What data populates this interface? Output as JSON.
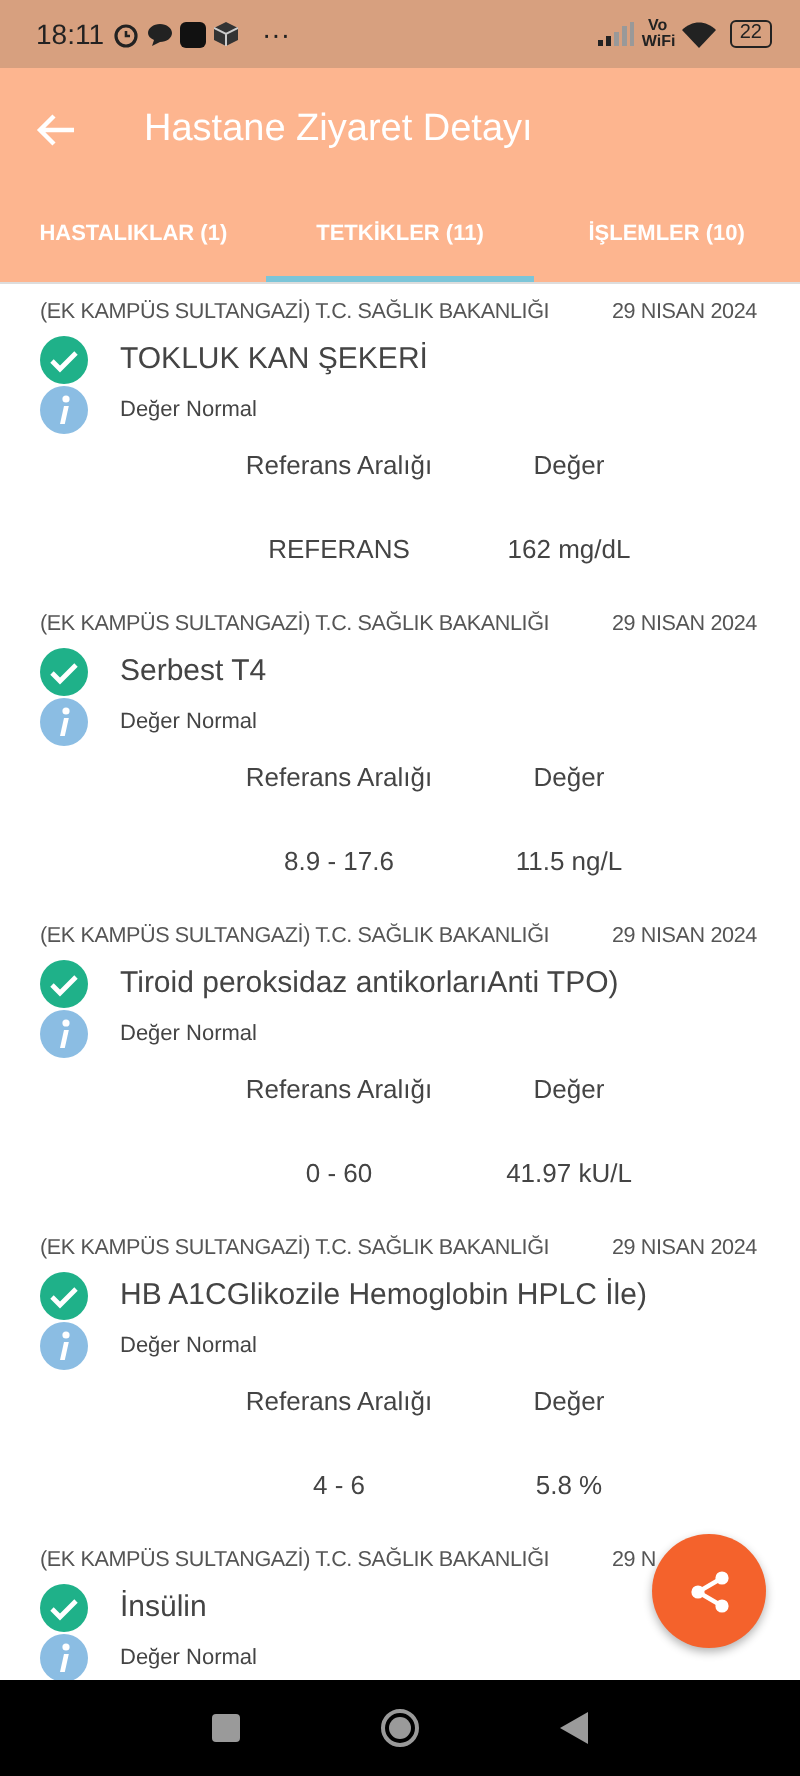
{
  "status_bar": {
    "time": "18:11",
    "overflow": "···",
    "network_label": "Vo WiFi",
    "battery": "22"
  },
  "app_bar": {
    "title": "Hastane Ziyaret Detayı"
  },
  "tabs": [
    {
      "label": "HASTALIKLAR (1)",
      "selected": false
    },
    {
      "label": "TETKİKLER (11)",
      "selected": true
    },
    {
      "label": "İŞLEMLER (10)",
      "selected": false
    }
  ],
  "tests": [
    {
      "institution": "(EK KAMPÜS SULTANGAZİ) T.C. SAĞLIK BAKANLIĞI",
      "date": "29 NISAN 2024",
      "name": "TOKLUK KAN ŞEKERİ",
      "status": "Değer Normal",
      "reference_label": "Referans Aralığı",
      "value_label": "Değer",
      "reference": "REFERANS",
      "value": "162 mg/dL"
    },
    {
      "institution": "(EK KAMPÜS SULTANGAZİ) T.C. SAĞLIK BAKANLIĞI",
      "date": "29 NISAN 2024",
      "name": "Serbest T4",
      "status": "Değer Normal",
      "reference_label": "Referans Aralığı",
      "value_label": "Değer",
      "reference": "8.9 - 17.6",
      "value": "11.5 ng/L"
    },
    {
      "institution": "(EK KAMPÜS SULTANGAZİ) T.C. SAĞLIK BAKANLIĞI",
      "date": "29 NISAN 2024",
      "name": "Tiroid peroksidaz antikorlarıAnti TPO)",
      "status": "Değer Normal",
      "reference_label": "Referans Aralığı",
      "value_label": "Değer",
      "reference": "0 - 60",
      "value": "41.97 kU/L"
    },
    {
      "institution": "(EK KAMPÜS SULTANGAZİ) T.C. SAĞLIK BAKANLIĞI",
      "date": "29 NISAN 2024",
      "name": "HB A1CGlikozile Hemoglobin HPLC İle)",
      "status": "Değer Normal",
      "reference_label": "Referans Aralığı",
      "value_label": "Değer",
      "reference": "4 - 6",
      "value": "5.8 %"
    },
    {
      "institution": "(EK KAMPÜS SULTANGAZİ) T.C. SAĞLIK BAKANLIĞI",
      "date": "29 N",
      "name": "İnsülin",
      "status": "Değer Normal"
    }
  ]
}
